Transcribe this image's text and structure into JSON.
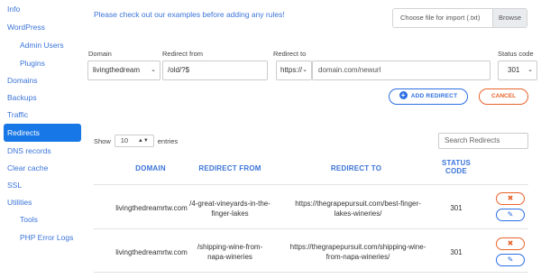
{
  "sidebar": {
    "items": [
      {
        "label": "Info"
      },
      {
        "label": "WordPress"
      },
      {
        "label": "Admin Users"
      },
      {
        "label": "Plugins"
      },
      {
        "label": "Domains"
      },
      {
        "label": "Backups"
      },
      {
        "label": "Traffic"
      },
      {
        "label": "Redirects"
      },
      {
        "label": "DNS records"
      },
      {
        "label": "Clear cache"
      },
      {
        "label": "SSL"
      },
      {
        "label": "Utilities"
      },
      {
        "label": "Tools"
      },
      {
        "label": "PHP Error Logs"
      }
    ],
    "active": "Redirects"
  },
  "notice": "Please check out our examples before adding any rules!",
  "import": {
    "placeholder": "Choose file for import (.txt)",
    "browse_label": "Browse"
  },
  "form": {
    "domain_label": "Domain",
    "domain_value": "livingthedream",
    "redirect_from_label": "Redirect from",
    "redirect_from_value": "/old/?$",
    "redirect_to_label": "Redirect to",
    "protocol_value": "https://",
    "redirect_to_value": "domain.com/newurl",
    "status_label": "Status code",
    "status_value": "301",
    "add_label": "ADD REDIRECT",
    "cancel_label": "CANCEL"
  },
  "table": {
    "show_label": "Show",
    "show_value": "10",
    "entries_label": "entries",
    "search_placeholder": "Search Redirects",
    "headers": {
      "domain": "DOMAIN",
      "from": "REDIRECT FROM",
      "to": "REDIRECT TO",
      "status_line1": "STATUS",
      "status_line2": "CODE"
    },
    "rows": [
      {
        "domain": "livingthedreamrtw.com",
        "from_line1": "/4-great-vineyards-in-the-",
        "from_line2": "finger-lakes",
        "to_line1": "https://thegrapepursuit.com/best-finger-",
        "to_line2": "lakes-wineries/",
        "status": "301"
      },
      {
        "domain": "livingthedreamrtw.com",
        "from_line1": "/shipping-wine-from-",
        "from_line2": "napa-wineries",
        "to_line1": "https://thegrapepursuit.com/shipping-wine-",
        "to_line2": "from-napa-wineries/",
        "status": "301"
      }
    ]
  },
  "icons": {
    "delete": "times-icon",
    "edit": "pencil-icon",
    "add": "plus-circle-icon"
  },
  "colors": {
    "accent": "#2c6fe3",
    "link": "#3b74d9",
    "active_bg": "#1877e6",
    "danger": "#e8632b"
  }
}
